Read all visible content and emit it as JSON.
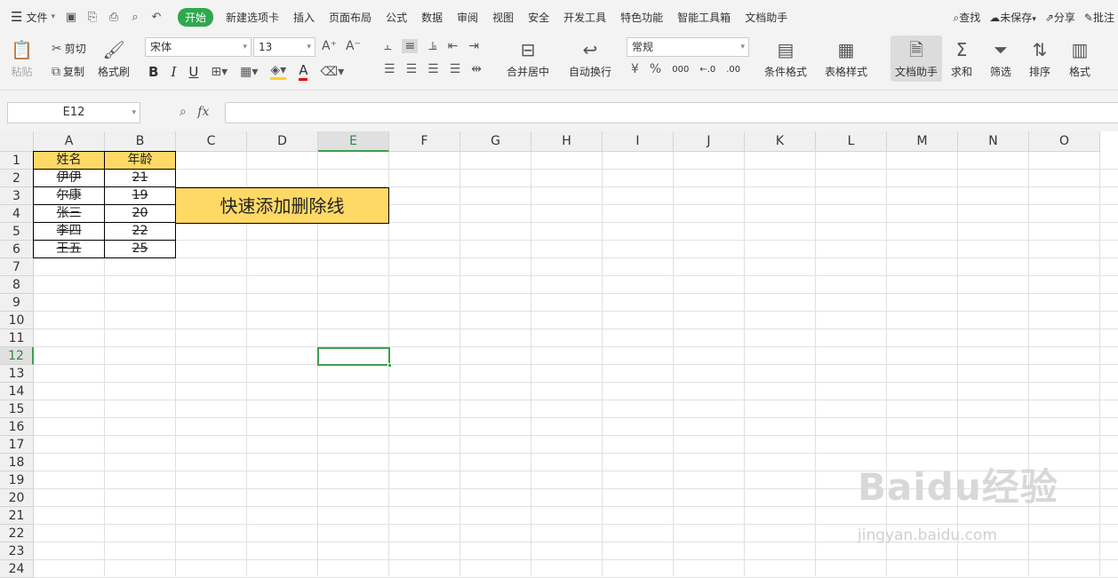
{
  "menu": {
    "file_label": "文件",
    "tabs": [
      "开始",
      "新建选项卡",
      "插入",
      "页面布局",
      "公式",
      "数据",
      "审阅",
      "视图",
      "安全",
      "开发工具",
      "特色功能",
      "智能工具箱",
      "文档助手"
    ],
    "active_tab": "开始",
    "search_label": "查找",
    "unsaved_label": "未保存",
    "share_label": "分享",
    "comment_label": "批注"
  },
  "ribbon": {
    "paste": "粘贴",
    "cut": "剪切",
    "copy": "复制",
    "format_painter": "格式刷",
    "font_name": "宋体",
    "font_size": "13",
    "merge_center": "合并居中",
    "wrap_text": "自动换行",
    "number_format": "常规",
    "conditional_format": "条件格式",
    "table_style": "表格样式",
    "doc_assistant": "文档助手",
    "sum": "求和",
    "filter": "筛选",
    "sort": "排序",
    "format": "格式",
    "bold": "B",
    "italic": "I",
    "underline": "U",
    "font_color": "A",
    "currency": "¥",
    "percent": "%",
    "thousands": "000",
    "inc_decimal": "←.0",
    "dec_decimal": ".00"
  },
  "formula_bar": {
    "name_box": "E12",
    "fx_label": "fx",
    "formula": ""
  },
  "columns": [
    "A",
    "B",
    "C",
    "D",
    "E",
    "F",
    "G",
    "H",
    "I",
    "J",
    "K",
    "L",
    "M",
    "N",
    "O"
  ],
  "rows": [
    "1",
    "2",
    "3",
    "4",
    "5",
    "6",
    "7",
    "8",
    "9",
    "10",
    "11",
    "12",
    "13",
    "14",
    "15",
    "16",
    "17",
    "18",
    "19",
    "20",
    "21",
    "22",
    "23",
    "24"
  ],
  "table": {
    "headers": [
      "姓名",
      "年龄"
    ],
    "rows": [
      [
        "伊伊",
        "21"
      ],
      [
        "尔康",
        "19"
      ],
      [
        "张三",
        "20"
      ],
      [
        "李四",
        "22"
      ],
      [
        "王五",
        "25"
      ]
    ]
  },
  "banner_text": "快速添加删除线",
  "active_cell": "E12",
  "watermark": {
    "main": "Baidu经验",
    "url": "jingyan.baidu.com"
  },
  "colors": {
    "accent": "#2fa84f",
    "header_fill": "#ffd966",
    "selection": "#3c9f4f"
  }
}
